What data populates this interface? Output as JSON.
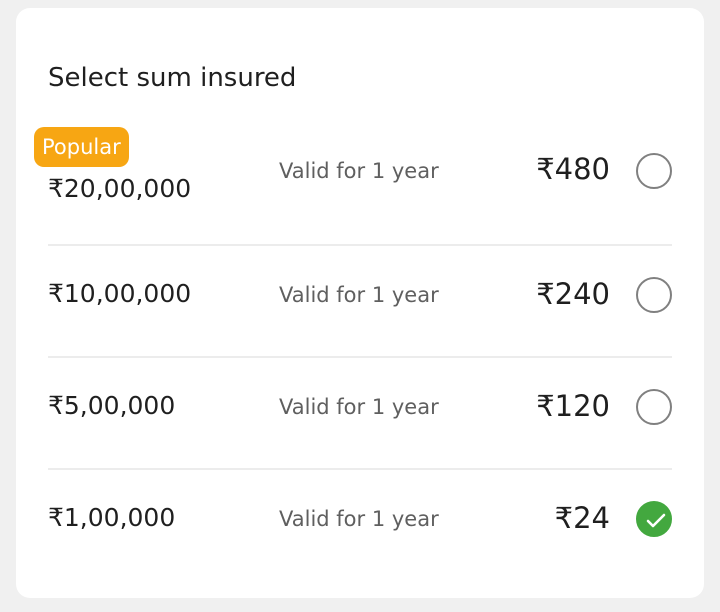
{
  "title": "Select sum insured",
  "badge": "Popular",
  "options": [
    {
      "sum": "₹20,00,000",
      "validity": "Valid for 1 year",
      "price": "₹480",
      "selected": false
    },
    {
      "sum": "₹10,00,000",
      "validity": "Valid for 1 year",
      "price": "₹240",
      "selected": false
    },
    {
      "sum": "₹5,00,000",
      "validity": "Valid for 1 year",
      "price": "₹120",
      "selected": false
    },
    {
      "sum": "₹1,00,000",
      "validity": "Valid for 1 year",
      "price": "₹24",
      "selected": true
    }
  ],
  "colors": {
    "badge": "#f7a613",
    "selected": "#43a83f"
  }
}
